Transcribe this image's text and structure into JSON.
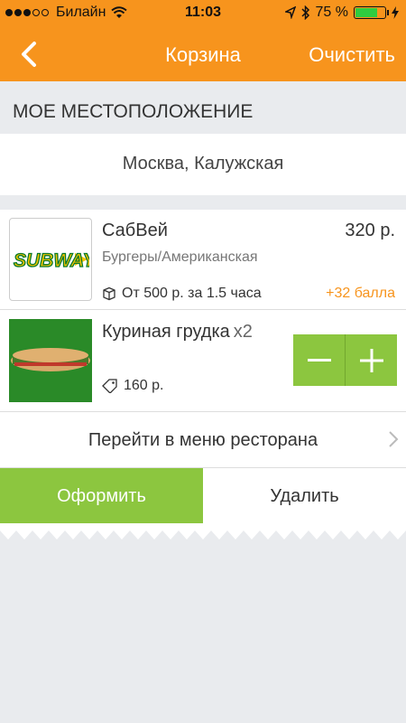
{
  "status_bar": {
    "carrier": "Билайн",
    "time": "11:03",
    "battery_percent": "75 %",
    "battery_level": 0.75
  },
  "nav": {
    "title": "Корзина",
    "clear_label": "Очистить"
  },
  "location": {
    "header": "МОЕ МЕСТОПОЛОЖЕНИЕ",
    "value": "Москва, Калужская"
  },
  "restaurant": {
    "logo_text": "SUBWAY",
    "name": "СабВей",
    "price": "320 р.",
    "cuisine": "Бургеры/Американская",
    "delivery": "От 500 р. за 1.5 часа",
    "bonus": "+32 балла"
  },
  "item": {
    "name": "Куриная грудка",
    "qty": "x2",
    "price": "160 р."
  },
  "menu_link": "Перейти в меню ресторана",
  "actions": {
    "checkout": "Оформить",
    "delete": "Удалить"
  },
  "colors": {
    "accent": "#f7941d",
    "green": "#8cc63f"
  }
}
